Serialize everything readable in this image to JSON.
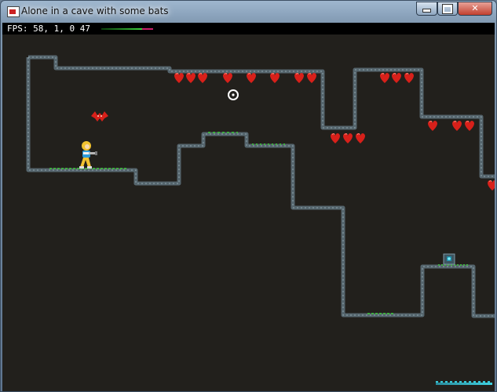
{
  "window": {
    "title": "Alone in a cave with some bats",
    "controls": [
      "minimize",
      "maximize",
      "close"
    ],
    "close_glyph": "✕"
  },
  "hud": {
    "fps_text": "FPS: 58, 1, 0 47"
  },
  "colors": {
    "cave_background": "#22201c",
    "rock_wall": "#5a6a72",
    "moss": "#3fae3f",
    "bat": "#d8201a",
    "hud_bar": "#000000"
  },
  "icons": {
    "app": "window-app-icon",
    "player": "player-character-icon",
    "crosshair": "crosshair-icon",
    "bat": "bat-icon",
    "chest": "treasure-chest-icon"
  }
}
